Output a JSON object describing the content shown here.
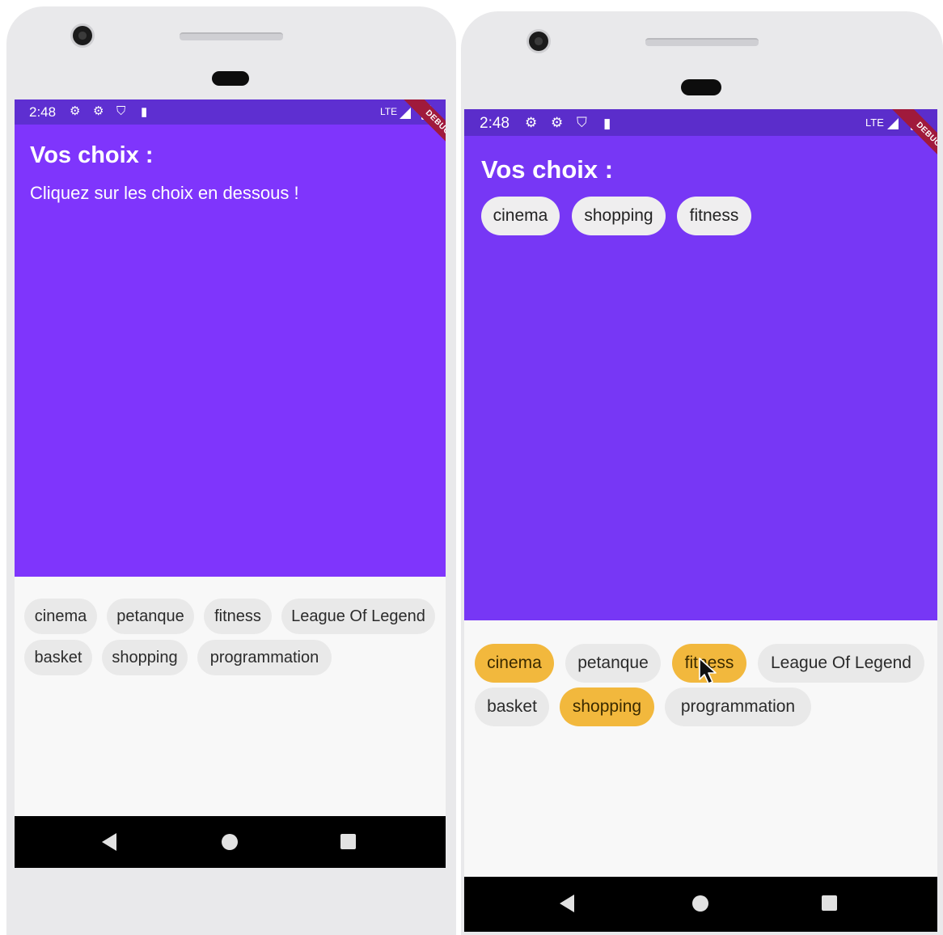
{
  "status": {
    "time": "2:48",
    "network": "LTE",
    "icons": [
      "gear-icon",
      "gear-icon",
      "shield-icon",
      "sd-card-icon"
    ]
  },
  "debug_banner": "DEBUG",
  "left": {
    "title": "Vos choix :",
    "hint": "Cliquez sur les choix en dessous !",
    "choices": [
      "cinema",
      "petanque",
      "fitness",
      "League Of Legend",
      "basket",
      "shopping",
      "programmation"
    ]
  },
  "right": {
    "title": "Vos choix :",
    "selected_chips": [
      "cinema",
      "shopping",
      "fitness"
    ],
    "choices": [
      "cinema",
      "petanque",
      "fitness",
      "League Of Legend",
      "basket",
      "shopping",
      "programmation"
    ],
    "selected": [
      "cinema",
      "fitness",
      "shopping"
    ]
  },
  "colors": {
    "header": "#7f35fc",
    "statusbar": "#5e2fd1",
    "selected_chip": "#f2b83d",
    "chip": "#e9e9e9"
  },
  "nav_icons": [
    "back-icon",
    "home-icon",
    "recents-icon"
  ]
}
